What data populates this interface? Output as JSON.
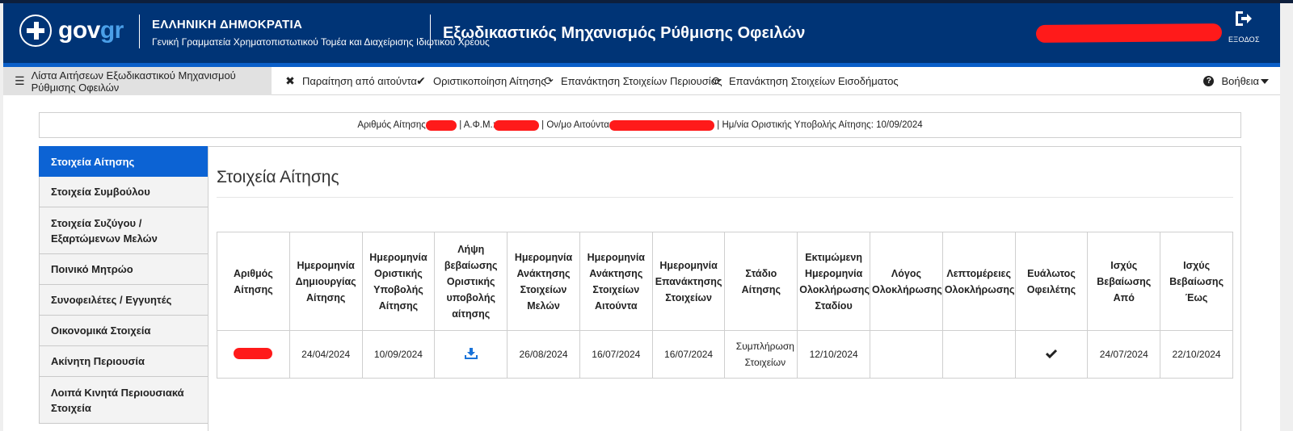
{
  "header": {
    "logo_gov": "gov",
    "logo_gr": "gr",
    "ministry_line1": "ΕΛΛΗΝΙΚΗ ΔΗΜΟΚΡΑΤΙΑ",
    "ministry_line2": "Γενική Γραμματεία Χρηματοπιστωτικού Τομέα και Διαχείρισης Ιδιωτικού Χρέους",
    "app_title": "Εξωδικαστικός Μηχανισμός Ρύθμισης Οφειλών",
    "logout_label": "ΕΞΟΔΟΣ"
  },
  "toolbar": {
    "items": [
      {
        "label": "Λίστα Αιτήσεων Εξωδικαστικού Μηχανισμού Ρύθμισης Οφειλών",
        "icon": "list-icon"
      },
      {
        "label": "Παραίτηση από αιτούντα",
        "icon": "close-icon"
      },
      {
        "label": "Οριστικοποίηση Αίτησης",
        "icon": "check-icon"
      },
      {
        "label": "Επανάκτηση Στοιχείων Περιουσίας",
        "icon": "refresh-icon"
      },
      {
        "label": "Επανάκτηση Στοιχείων Εισοδήματος",
        "icon": "refresh-icon"
      }
    ],
    "help_label": "Βοήθεια"
  },
  "infobar": {
    "app_no_label": "Αριθμός Αίτησης:",
    "afm_label": " | Α.Φ.Μ.:",
    "name_label": " | Ον/μο Αιτούντα:",
    "date_label": " | Ημ/νία Οριστικής Υποβολής Αίτησης: 10/09/2024"
  },
  "sidebar": {
    "items": [
      {
        "label": "Στοιχεία Αίτησης"
      },
      {
        "label": "Στοιχεία Συμβούλου"
      },
      {
        "label": "Στοιχεία Συζύγου / Εξαρτώμενων Μελών"
      },
      {
        "label": "Ποινικό Μητρώο"
      },
      {
        "label": "Συνοφειλέτες / Εγγυητές"
      },
      {
        "label": "Οικονομικά Στοιχεία"
      },
      {
        "label": "Ακίνητη Περιουσία"
      },
      {
        "label": "Λοιπά Κινητά Περιουσιακά Στοιχεία"
      }
    ]
  },
  "panel": {
    "title": "Στοιχεία Αίτησης"
  },
  "table": {
    "headers": [
      "Αριθμός Αίτησης",
      "Ημερομηνία Δημιουργίας Αίτησης",
      "Ημερομηνία Οριστικής Υποβολής Αίτησης",
      "Λήψη βεβαίωσης Οριστικής υποβολής αίτησης",
      "Ημερομηνία Ανάκτησης Στοιχείων Μελών",
      "Ημερομηνία Ανάκτησης Στοιχείων Αιτούντα",
      "Ημερομηνία Επανάκτησης Στοιχείων",
      "Στάδιο Αίτησης",
      "Εκτιμώμενη Ημερομηνία Ολοκλήρωσης Σταδίου",
      "Λόγος Ολοκλήρωσης",
      "Λεπτομέρειες Ολοκλήρωσης",
      "Ευάλωτος Οφειλέτης",
      "Ισχύς Βεβαίωσης Από",
      "Ισχύς Βεβαίωσης Έως"
    ],
    "row": {
      "created": "24/04/2024",
      "submitted": "10/09/2024",
      "download_icon": "download-icon",
      "members_retrieved": "26/08/2024",
      "applicant_retrieved": "16/07/2024",
      "reretrieved": "16/07/2024",
      "stage": "Συμπλήρωση Στοιχείων",
      "estimated_completion": "12/10/2024",
      "completion_reason": "",
      "completion_details": "",
      "vulnerable": "check-icon",
      "valid_from": "24/07/2024",
      "valid_to": "22/10/2024"
    }
  },
  "colors": {
    "header_bg": "#003476",
    "accent_blue": "#0c63d4",
    "redaction": "#ff1a1a"
  }
}
